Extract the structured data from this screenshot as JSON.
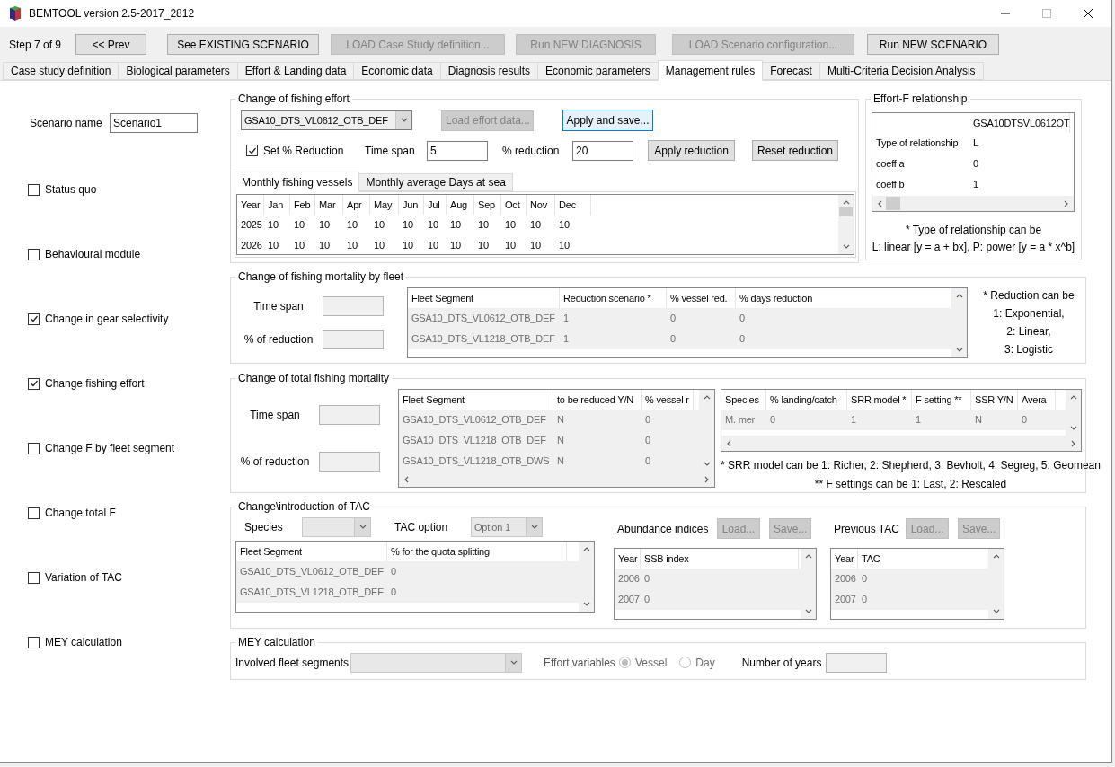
{
  "window": {
    "title": "BEMTOOL version 2.5-2017_2812"
  },
  "toolbar": {
    "step": "Step 7 of 9",
    "buttons": [
      {
        "label": "<< Prev",
        "disabled": false
      },
      {
        "label": "See EXISTING SCENARIO",
        "disabled": false
      },
      {
        "label": "LOAD Case Study definition...",
        "disabled": true
      },
      {
        "label": "Run NEW DIAGNOSIS",
        "disabled": true
      },
      {
        "label": "LOAD Scenario configuration...",
        "disabled": true
      },
      {
        "label": "Run NEW SCENARIO",
        "disabled": false
      }
    ]
  },
  "tabs": [
    {
      "label": "Case study definition",
      "selected": false
    },
    {
      "label": "Biological parameters",
      "selected": false
    },
    {
      "label": "Effort & Landing data",
      "selected": false
    },
    {
      "label": "Economic data",
      "selected": false
    },
    {
      "label": "Diagnosis results",
      "selected": false
    },
    {
      "label": "Economic parameters",
      "selected": false
    },
    {
      "label": "Management rules",
      "selected": true
    },
    {
      "label": "Forecast",
      "selected": false
    },
    {
      "label": "Multi-Criteria Decision Analysis",
      "selected": false
    }
  ],
  "scenario_name": {
    "label": "Scenario name",
    "value": "Scenario1"
  },
  "options": [
    {
      "label": "Status quo",
      "checked": false
    },
    {
      "label": "Behavioural module",
      "checked": false
    },
    {
      "label": "Change in gear selectivity",
      "checked": true
    },
    {
      "label": "Change fishing effort",
      "checked": true
    },
    {
      "label": "Change F by fleet segment",
      "checked": false
    },
    {
      "label": "Change total F",
      "checked": false
    },
    {
      "label": "Variation of TAC",
      "checked": false
    },
    {
      "label": "MEY calculation",
      "checked": false
    }
  ],
  "fishing_effort": {
    "title": "Change of fishing effort",
    "fleet_select": "GSA10_DTS_VL0612_OTB_DEF",
    "load_button": {
      "label": "Load effort data...",
      "disabled": true
    },
    "save_button": {
      "label": "Apply and save...",
      "focused": true
    },
    "set_reduction": {
      "label": "Set % Reduction",
      "checked": true
    },
    "time_span": {
      "label": "Time span",
      "value": "5"
    },
    "reduction": {
      "label": "% reduction",
      "value": "20"
    },
    "buttons": [
      "Apply reduction",
      "Reset reduction"
    ],
    "subtabs": [
      {
        "label": "Monthly fishing vessels",
        "selected": true
      },
      {
        "label": "Monthly average Days at sea",
        "selected": false
      }
    ],
    "table": {
      "columns": [
        "Year",
        "Jan",
        "Feb",
        "Mar",
        "Apr",
        "May",
        "Jun",
        "Jul",
        "Aug",
        "Sep",
        "Oct",
        "Nov",
        "Dec"
      ],
      "rows": [
        [
          "2025",
          "10",
          "10",
          "10",
          "10",
          "10",
          "10",
          "10",
          "10",
          "10",
          "10",
          "10",
          "10"
        ],
        [
          "2026",
          "10",
          "10",
          "10",
          "10",
          "10",
          "10",
          "10",
          "10",
          "10",
          "10",
          "10",
          "10"
        ]
      ]
    }
  },
  "effort_f": {
    "title": "Effort-F relationship",
    "column": "GSA10DTSVL0612OT",
    "rows": [
      [
        "Type of relationship",
        "L"
      ],
      [
        "coeff a",
        "0"
      ],
      [
        "coeff b",
        "1"
      ]
    ],
    "notes": [
      "* Type of relationship can be",
      "L: linear [y = a + bx], P: power [y = a * x^b]"
    ]
  },
  "fleet_mortality": {
    "title": "Change of fishing mortality by fleet",
    "time_span_label": "Time span",
    "reduction_label": "% of reduction",
    "table": {
      "columns": [
        "Fleet Segment",
        "Reduction scenario *",
        "% vessel red.",
        "% days reduction"
      ],
      "rows": [
        [
          "GSA10_DTS_VL0612_OTB_DEF",
          "1",
          "0",
          "0"
        ],
        [
          "GSA10_DTS_VL1218_OTB_DEF",
          "1",
          "0",
          "0"
        ]
      ]
    },
    "notes": [
      "* Reduction can be",
      "1: Exponential,",
      "2: Linear,",
      "3: Logistic"
    ]
  },
  "total_mortality": {
    "title": "Change of total fishing mortality",
    "time_span_label": "Time span",
    "reduction_label": "% of reduction",
    "fleet_table": {
      "columns": [
        "Fleet Segment",
        "to be reduced Y/N",
        "% vessel r"
      ],
      "rows": [
        [
          "GSA10_DTS_VL0612_OTB_DEF",
          "N",
          "0"
        ],
        [
          "GSA10_DTS_VL1218_OTB_DEF",
          "N",
          "0"
        ],
        [
          "GSA10_DTS_VL1218_OTB_DWS",
          "N",
          "0"
        ]
      ]
    },
    "species_table": {
      "columns": [
        "Species",
        "% landing/catch",
        "SRR model *",
        "F setting **",
        "SSR Y/N",
        "Avera"
      ],
      "rows": [
        [
          "M. mer",
          "0",
          "1",
          "1",
          "N",
          "0"
        ]
      ]
    },
    "notes": [
      "* SRR model can be 1: Richer, 2: Shepherd, 3: Bevholt, 4: Segreg, 5: Geomean",
      "** F settings can be 1: Last, 2: Rescaled"
    ]
  },
  "tac": {
    "title": "Change\\introduction of TAC",
    "species_label": "Species",
    "tac_option_label": "TAC option",
    "tac_option_value": "Option 1",
    "fleet_table": {
      "columns": [
        "Fleet Segment",
        "% for the quota splitting"
      ],
      "rows": [
        [
          "GSA10_DTS_VL0612_OTB_DEF",
          "0"
        ],
        [
          "GSA10_DTS_VL1218_OTB_DEF",
          "0"
        ]
      ]
    },
    "abundance": {
      "label": "Abundance indices",
      "buttons": [
        "Load...",
        "Save..."
      ],
      "table": {
        "columns": [
          "Year",
          "SSB index"
        ],
        "rows": [
          [
            "2006",
            "0"
          ],
          [
            "2007",
            "0"
          ]
        ]
      }
    },
    "previous_tac": {
      "label": "Previous TAC",
      "buttons": [
        "Load...",
        "Save..."
      ],
      "table": {
        "columns": [
          "Year",
          "TAC"
        ],
        "rows": [
          [
            "2006",
            "0"
          ],
          [
            "2007",
            "0"
          ]
        ]
      }
    }
  },
  "mey": {
    "title": "MEY calculation",
    "fleet_label": "Involved fleet segments",
    "effort_label": "Effort variables",
    "radios": [
      {
        "label": "Vessel",
        "selected": true
      },
      {
        "label": "Day",
        "selected": false
      }
    ],
    "years_label": "Number of years"
  }
}
